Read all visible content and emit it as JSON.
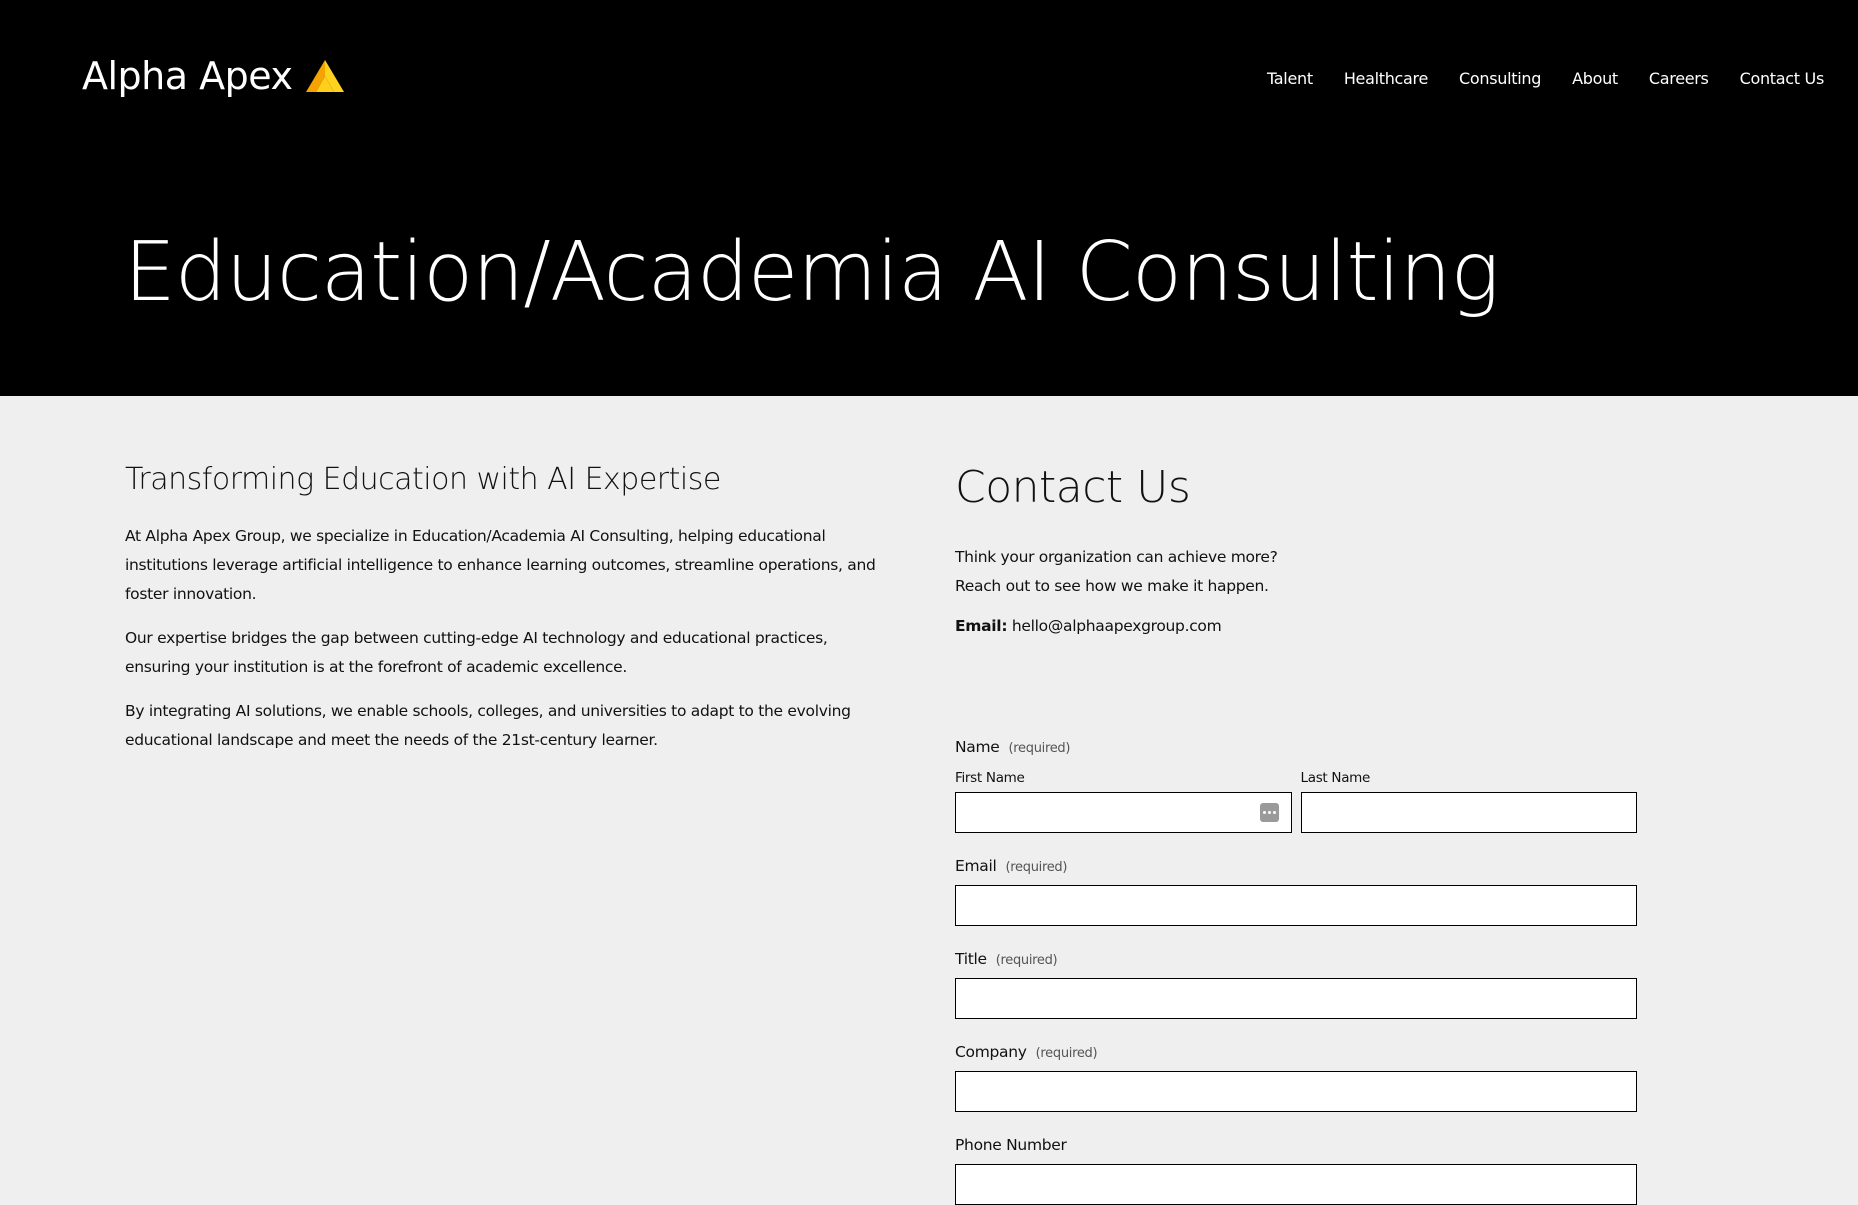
{
  "header": {
    "logo_text": "Alpha Apex",
    "nav": [
      {
        "label": "Talent"
      },
      {
        "label": "Healthcare"
      },
      {
        "label": "Consulting"
      },
      {
        "label": "About"
      },
      {
        "label": "Careers"
      },
      {
        "label": "Contact Us"
      }
    ]
  },
  "hero": {
    "title": "Education/Academia AI Consulting"
  },
  "main": {
    "heading": "Transforming Education with AI Expertise",
    "paragraphs": [
      "At Alpha Apex Group, we specialize in Education/Academia AI Consulting, helping educational institutions leverage artificial intelligence to enhance learning outcomes, streamline operations, and foster innovation.",
      "Our expertise bridges the gap between cutting-edge AI technology and educational practices, ensuring your institution is at the forefront of academic excellence.",
      "By integrating AI solutions, we enable schools, colleges, and universities to adapt to the evolving educational landscape and meet the needs of the 21st-century learner."
    ]
  },
  "contact": {
    "title": "Contact Us",
    "intro_line1": "Think your organization can achieve more?",
    "intro_line2": "Reach out to see how we make it happen.",
    "email_label": "Email:",
    "email_value": "hello@alphaapexgroup.com"
  },
  "form": {
    "required_note": "(required)",
    "name_label": "Name",
    "first_name_label": "First Name",
    "last_name_label": "Last Name",
    "email_label": "Email",
    "title_label": "Title",
    "company_label": "Company",
    "phone_label": "Phone Number",
    "first_name_value": "",
    "last_name_value": "",
    "email_value": "",
    "title_value": "",
    "company_value": "",
    "phone_value": ""
  },
  "colors": {
    "hero_bg": "#000000",
    "page_bg": "#efefef",
    "logo_mark_left": "#f5a300",
    "logo_mark_right": "#ffd21f"
  },
  "icons": {
    "logo_mark": "apex-triangle-icon",
    "autofill": "autofill-dots-icon"
  }
}
